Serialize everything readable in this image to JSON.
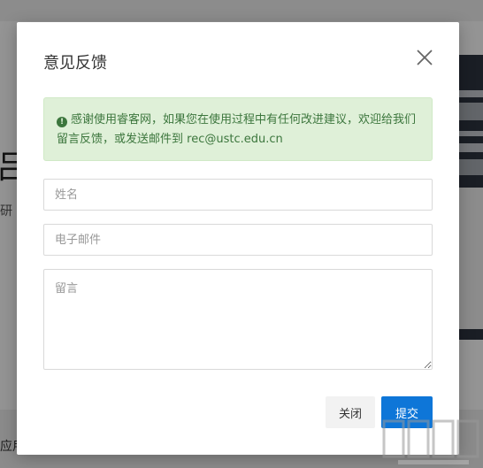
{
  "background": {
    "heading_fragment": "吕",
    "sub_fragment": "研",
    "footer_fragment": "应用"
  },
  "dialog": {
    "title": "意见反馈",
    "notice": "感谢使用睿客网，如果您在使用过程中有任何改进建议，欢迎给我们留言反馈，或发送邮件到 rec@ustc.edu.cn",
    "name_placeholder": "姓名",
    "email_placeholder": "电子邮件",
    "message_placeholder": "留言",
    "close_label": "关闭",
    "submit_label": "提交"
  },
  "icons": {
    "close": "close-icon",
    "alert": "exclamation-circle-icon"
  },
  "colors": {
    "primary": "#0e76d8",
    "success_bg": "#dff0d8",
    "success_text": "#3c763d"
  }
}
